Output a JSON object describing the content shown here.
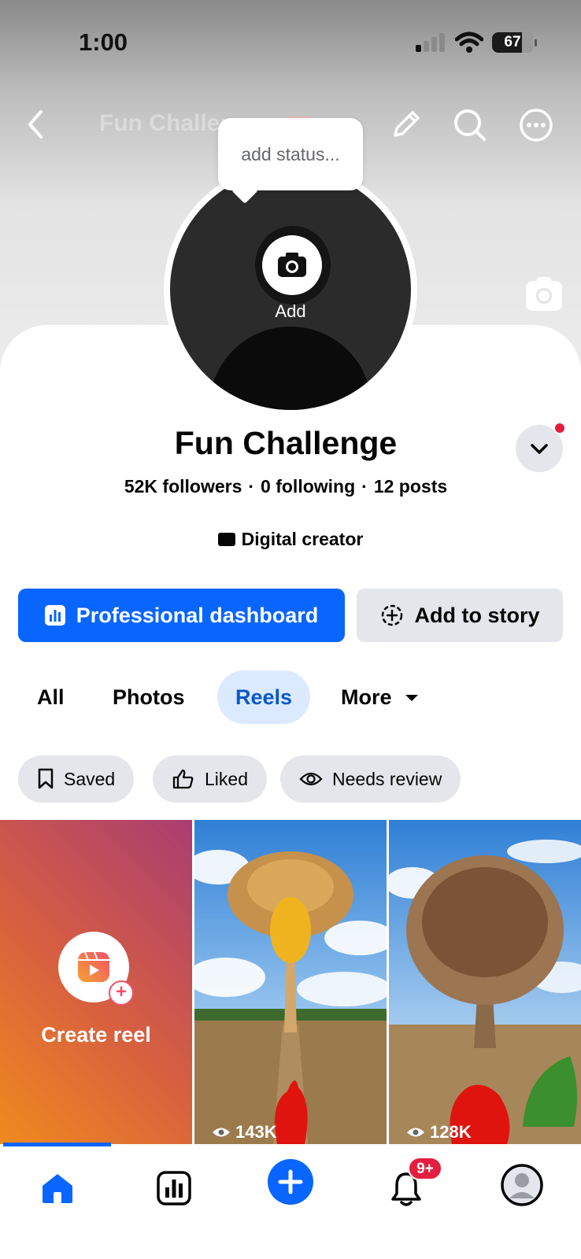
{
  "status_bar": {
    "time": "1:00",
    "battery": "67"
  },
  "header": {
    "title": "Fun Challenge"
  },
  "avatar": {
    "status_placeholder": "add status...",
    "add_label": "Add"
  },
  "profile": {
    "name": "Fun Challenge",
    "followers": "52K followers",
    "following": "0 following",
    "posts": "12 posts",
    "separator": "·",
    "category": "Digital creator"
  },
  "actions": {
    "primary": "Professional dashboard",
    "secondary": "Add to story"
  },
  "tabs": [
    {
      "label": "All",
      "active": false
    },
    {
      "label": "Photos",
      "active": false
    },
    {
      "label": "Reels",
      "active": true
    },
    {
      "label": "More",
      "active": false
    }
  ],
  "filters": [
    {
      "label": "Saved",
      "icon": "bookmark-icon"
    },
    {
      "label": "Liked",
      "icon": "thumbs-up-icon"
    },
    {
      "label": "Needs review",
      "icon": "eye-icon"
    }
  ],
  "reels": {
    "create_label": "Create reel",
    "items": [
      {
        "views": "143K"
      },
      {
        "views": "128K"
      }
    ]
  },
  "bottom_nav": {
    "notifications_badge": "9+"
  },
  "colors": {
    "accent": "#0866ff",
    "badge": "#e41e3f",
    "active_tab_bg": "#dbeafe"
  }
}
